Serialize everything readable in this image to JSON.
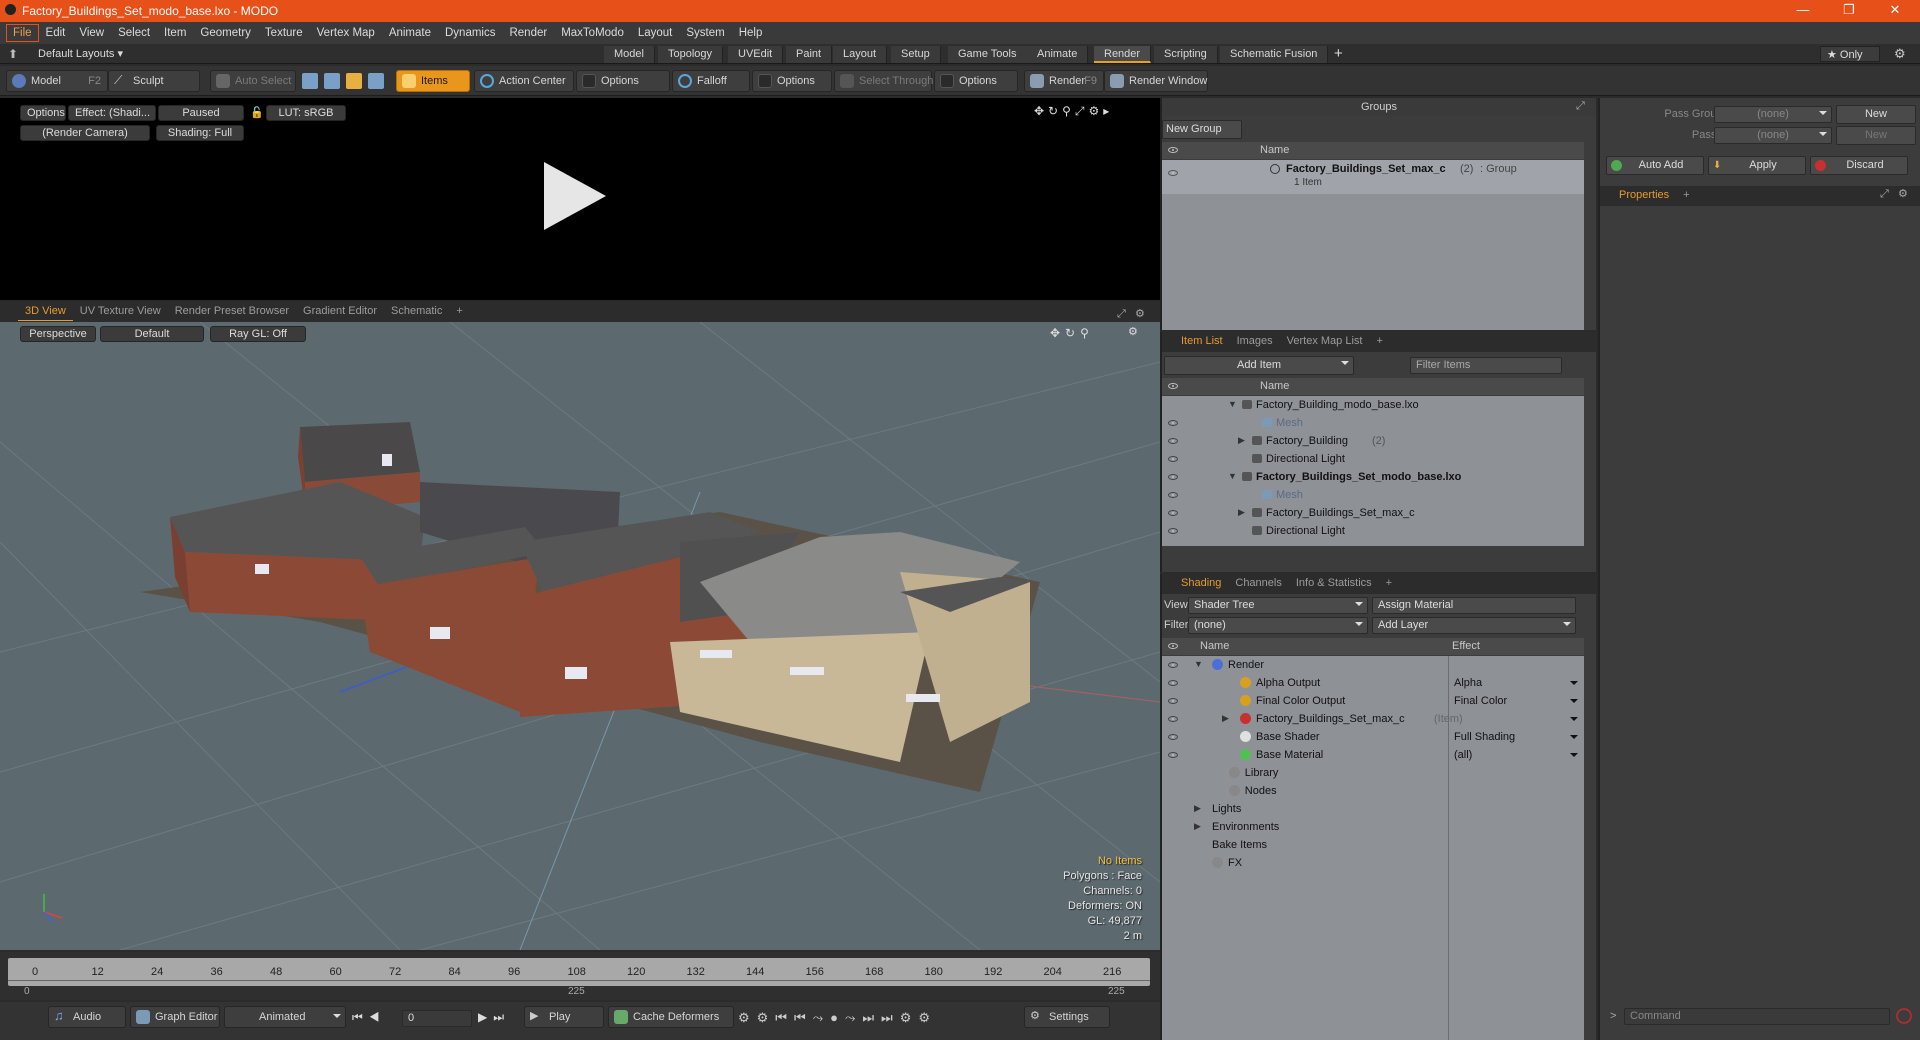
{
  "window": {
    "title": "Factory_Buildings_Set_modo_base.lxo - MODO",
    "minimize": "—",
    "maximize": "❐",
    "close": "✕"
  },
  "menus": [
    "File",
    "Edit",
    "View",
    "Select",
    "Item",
    "Geometry",
    "Texture",
    "Vertex Map",
    "Animate",
    "Dynamics",
    "Render",
    "MaxToModo",
    "Layout",
    "System",
    "Help"
  ],
  "layoutbar": {
    "default_layouts": "Default Layouts ▾",
    "tabs": [
      "Model",
      "Topology",
      "UVEdit",
      "Paint",
      "Layout",
      "Setup",
      "Game Tools",
      "Animate",
      "Render",
      "Scripting",
      "Schematic Fusion"
    ],
    "active_tab": "Render",
    "add": "+",
    "only": "★  Only"
  },
  "toolbar": {
    "model": "Model",
    "model_key": "F2",
    "sculpt": "Sculpt",
    "auto_select": "Auto Select",
    "items": "Items",
    "action_center": "Action Center",
    "options1": "Options",
    "falloff": "Falloff",
    "options2": "Options",
    "select_through": "Select Through",
    "options3": "Options",
    "render": "Render",
    "render_key": "F9",
    "render_window": "Render Window"
  },
  "render_view": {
    "options": "Options",
    "effect": "Effect: (Shadi...",
    "paused": "Paused",
    "lut": "LUT: sRGB",
    "camera": "(Render Camera)",
    "shading": "Shading: Full"
  },
  "view_tabs": {
    "items": [
      "3D View",
      "UV Texture View",
      "Render Preset Browser",
      "Gradient Editor",
      "Schematic"
    ],
    "active": "3D View",
    "add": "+"
  },
  "viewport": {
    "perspective": "Perspective",
    "default": "Default",
    "raygl": "Ray GL: Off",
    "hud": {
      "no_items": "No Items",
      "polygons": "Polygons : Face",
      "channels": "Channels: 0",
      "deformers": "Deformers: ON",
      "gl": "GL: 49,877",
      "scale": "2 m"
    }
  },
  "timeline": {
    "ticks": [
      "0",
      "12",
      "24",
      "36",
      "48",
      "60",
      "72",
      "84",
      "96",
      "108",
      "120",
      "132",
      "144",
      "156",
      "168",
      "180",
      "192",
      "204",
      "216"
    ],
    "sub_start": "0",
    "sub_mid": "225",
    "sub_end": "225"
  },
  "bottombar": {
    "audio": "Audio",
    "graph_editor": "Graph Editor",
    "animated": "Animated",
    "frame": "0",
    "play": "Play",
    "cache_deformers": "Cache Deformers",
    "settings": "Settings"
  },
  "groups": {
    "title": "Groups",
    "new_group": "New Group",
    "col_name": "Name",
    "item_name": "Factory_Buildings_Set_max_c",
    "item_count": "(2)",
    "item_type": ": Group",
    "item_sub": "1 Item"
  },
  "item_list": {
    "tabs": [
      "Item List",
      "Images",
      "Vertex Map List"
    ],
    "active": "Item List",
    "add_item": "Add Item",
    "filter": "Filter Items",
    "col_name": "Name",
    "rows": [
      {
        "label": "Factory_Building_modo_base.lxo",
        "indent": 0,
        "bold": false,
        "dim": false,
        "expand": "▼",
        "eye": false
      },
      {
        "label": "Mesh",
        "indent": 2,
        "bold": false,
        "dim": true,
        "expand": "",
        "eye": true
      },
      {
        "label": "Factory_Building",
        "suffix": "(2)",
        "indent": 1,
        "bold": false,
        "dim": false,
        "expand": "▶",
        "eye": true
      },
      {
        "label": "Directional Light",
        "indent": 1,
        "bold": false,
        "dim": false,
        "expand": "",
        "eye": true
      },
      {
        "label": "Factory_Buildings_Set_modo_base.lxo",
        "indent": 0,
        "bold": true,
        "dim": false,
        "expand": "▼",
        "eye": true
      },
      {
        "label": "Mesh",
        "indent": 2,
        "bold": false,
        "dim": true,
        "expand": "",
        "eye": true
      },
      {
        "label": "Factory_Buildings_Set_max_c",
        "indent": 1,
        "bold": false,
        "dim": false,
        "expand": "▶",
        "eye": true
      },
      {
        "label": "Directional Light",
        "indent": 1,
        "bold": false,
        "dim": false,
        "expand": "",
        "eye": true
      }
    ]
  },
  "shading": {
    "tabs": [
      "Shading",
      "Channels",
      "Info & Statistics"
    ],
    "active": "Shading",
    "view_label": "View",
    "view_value": "Shader Tree",
    "assign_material": "Assign Material",
    "filter_label": "Filter",
    "filter_value": "(none)",
    "add_layer": "Add Layer",
    "col_name": "Name",
    "col_effect": "Effect",
    "rows": [
      {
        "label": "Render",
        "effect": "",
        "indent": 0,
        "icon": "#4a6fd8",
        "eye": true,
        "expand": "▼"
      },
      {
        "label": "Alpha Output",
        "effect": "Alpha",
        "indent": 1,
        "icon": "#d8a020",
        "eye": true,
        "expand": ""
      },
      {
        "label": "Final Color Output",
        "effect": "Final Color",
        "indent": 1,
        "icon": "#d8a020",
        "eye": true,
        "expand": ""
      },
      {
        "label": "Factory_Buildings_Set_max_c",
        "suffix": "(Item)",
        "effect": "",
        "indent": 1,
        "icon": "#c83030",
        "eye": true,
        "expand": "▶"
      },
      {
        "label": "Base Shader",
        "effect": "Full Shading",
        "indent": 1,
        "icon": "#e0e0e0",
        "eye": true,
        "expand": ""
      },
      {
        "label": "Base Material",
        "effect": "(all)",
        "indent": 1,
        "icon": "#50c050",
        "eye": true,
        "expand": ""
      },
      {
        "label": "Library",
        "effect": "",
        "indent": 0.6,
        "icon": "#888",
        "eye": false,
        "expand": ""
      },
      {
        "label": "Nodes",
        "effect": "",
        "indent": 0.6,
        "icon": "#888",
        "eye": false,
        "expand": ""
      },
      {
        "label": "Lights",
        "effect": "",
        "indent": 0,
        "icon": "",
        "eye": false,
        "expand": "▶"
      },
      {
        "label": "Environments",
        "effect": "",
        "indent": 0,
        "icon": "",
        "eye": false,
        "expand": "▶"
      },
      {
        "label": "Bake Items",
        "effect": "",
        "indent": 0,
        "icon": "",
        "eye": false,
        "expand": ""
      },
      {
        "label": "FX",
        "effect": "",
        "indent": 0,
        "icon": "#888",
        "eye": false,
        "expand": ""
      }
    ]
  },
  "passes": {
    "pass_groups_label": "Pass Groups",
    "pass_groups_value": "(none)",
    "passes_label": "Passes",
    "passes_value": "(none)",
    "new1": "New",
    "new2": "New",
    "auto_add": "Auto Add",
    "apply": "Apply",
    "discard": "Discard",
    "properties_tab": "Properties",
    "add": "+",
    "command_placeholder": "Command"
  },
  "colors": {
    "accent": "#e8961c",
    "title": "#e8501a"
  }
}
